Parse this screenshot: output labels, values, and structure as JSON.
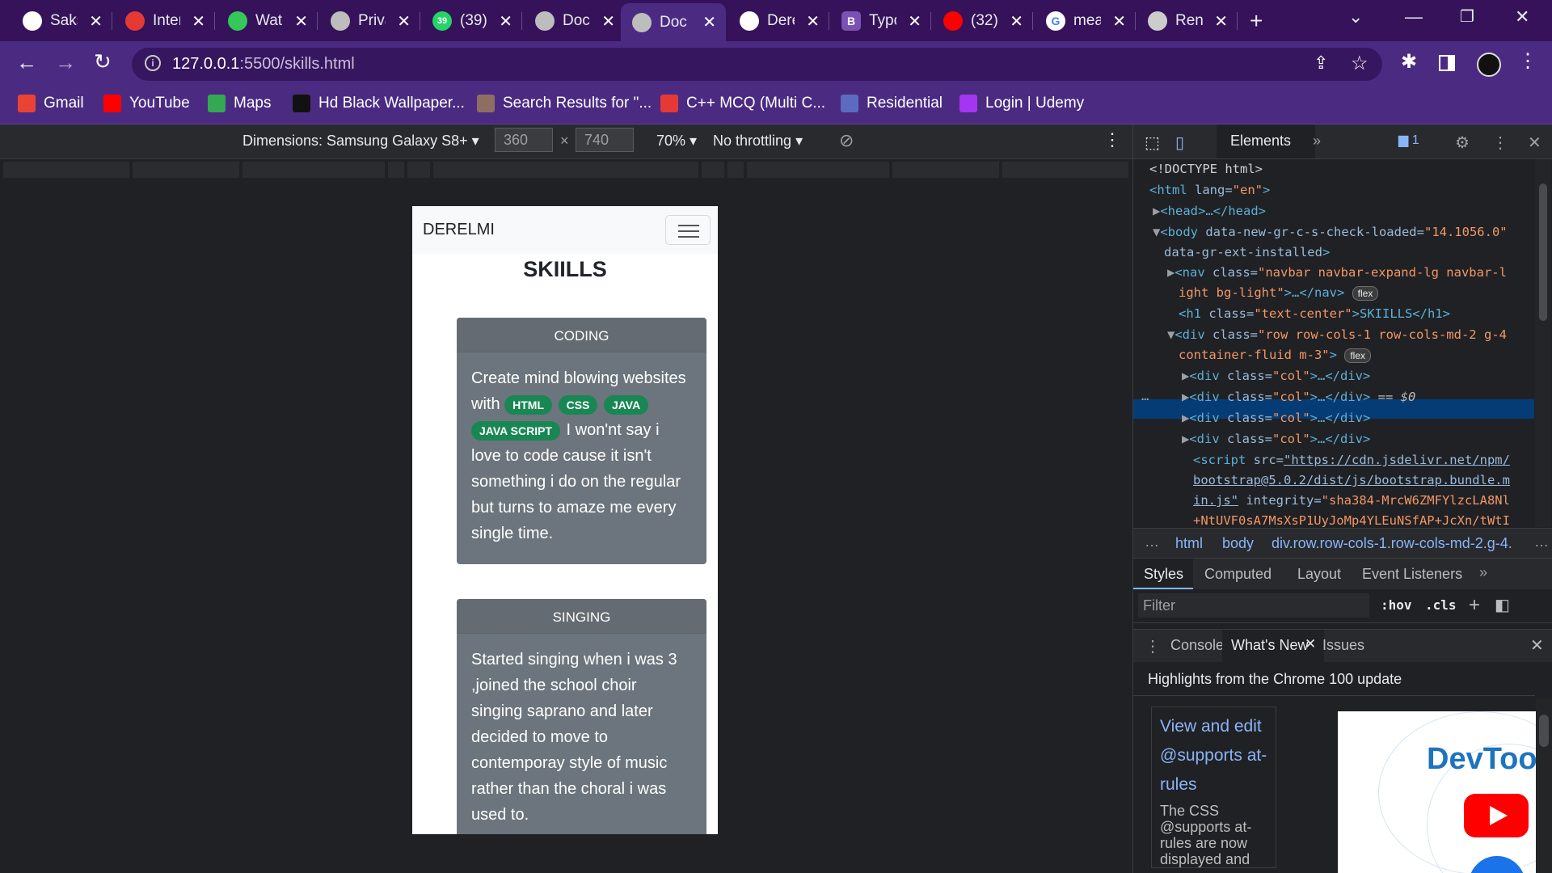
{
  "browser": {
    "tabs": [
      {
        "title": "Sakshi",
        "icon": "wallet-icon",
        "color": "#ffffff"
      },
      {
        "title": "Internet",
        "icon": "speed-icon",
        "color": "#e53935"
      },
      {
        "title": "Watch",
        "icon": "play-icon",
        "color": "#34c759"
      },
      {
        "title": "Privacy",
        "icon": "globe-icon",
        "color": "#bdbdbd"
      },
      {
        "title": "(39)",
        "icon": "whatsapp-icon",
        "color": "#25d366",
        "badge": "39"
      },
      {
        "title": "Docs",
        "icon": "globe-icon",
        "color": "#bdbdbd"
      },
      {
        "title": "Docs",
        "icon": "globe-icon",
        "color": "#bdbdbd",
        "active": true
      },
      {
        "title": "Derelmi",
        "icon": "github-icon",
        "color": "#ffffff"
      },
      {
        "title": "Typography",
        "icon": "bootstrap-icon",
        "color": "#7952b3",
        "letter": "B"
      },
      {
        "title": "(32)",
        "icon": "youtube-icon",
        "color": "#ff0000"
      },
      {
        "title": "meaning",
        "icon": "google-icon",
        "color": "#ffffff",
        "letter": "G"
      },
      {
        "title": "Render",
        "icon": "layers-icon",
        "color": "#cccccc"
      }
    ],
    "url_host": "127.0.0.1",
    "url_path": ":5500/skills.html",
    "bookmarks": [
      {
        "label": "Gmail",
        "icon": "gmail-icon",
        "color": "#ea4335"
      },
      {
        "label": "YouTube",
        "icon": "youtube-icon",
        "color": "#ff0000"
      },
      {
        "label": "Maps",
        "icon": "maps-icon",
        "color": "#34a853"
      },
      {
        "label": "Hd Black Wallpaper...",
        "icon": "wallpaper-icon",
        "color": "#111111"
      },
      {
        "label": "Search Results for \"...",
        "icon": "search-results-icon",
        "color": "#8d6e63"
      },
      {
        "label": "C++ MCQ (Multi C...",
        "icon": "cpp-icon",
        "color": "#e53935"
      },
      {
        "label": "Residential",
        "icon": "residential-icon",
        "color": "#5c6bc0"
      },
      {
        "label": "Login | Udemy",
        "icon": "udemy-icon",
        "color": "#a435f0"
      }
    ]
  },
  "device_toolbar": {
    "dimensions_label": "Dimensions: Samsung Galaxy S8+",
    "width": "360",
    "height": "740",
    "times": "×",
    "zoom": "70%",
    "throttling": "No throttling"
  },
  "page": {
    "brand": "DERELMI",
    "heading": "SKIILLS",
    "cards": [
      {
        "header": "CODING",
        "text_before": "Create mind blowing websites with",
        "badges": [
          "HTML",
          "CSS",
          "JAVA",
          "JAVA SCRIPT"
        ],
        "text_after": "I won'nt say i love to code cause it isn't something i do on the regular but turns to amaze me every single time."
      },
      {
        "header": "SINGING",
        "text": "Started singing when i was 3 ,joined the school choir singing saprano and later decided to move to contemporay style of music rather than the choral i was used to."
      }
    ]
  },
  "devtools": {
    "main_tab": "Elements",
    "issues_count": "1",
    "tree": {
      "l1": "<!DOCTYPE html>",
      "l2_tag": "<html",
      "l2_attr": " lang=",
      "l2_val": "\"en\"",
      "l2_end": ">",
      "l3": "<head>…</head>",
      "l4_tag": "<body",
      "l4_attr": " data-new-gr-c-s-check-loaded=",
      "l4_val": "\"14.1056.0\"",
      "l5_attr": "data-gr-ext-installed",
      "l5_end": ">",
      "l6_tag": "<nav",
      "l6_attr": " class=",
      "l6_val": "\"navbar navbar-expand-lg navbar-l",
      "l7_val": "ight bg-light\"",
      "l7_end": ">…</nav>",
      "flex": "flex",
      "l8_tag": "<h1",
      "l8_attr": " class=",
      "l8_val": "\"text-center\"",
      "l8_end": ">SKIILLS</h1>",
      "l9_tag": "<div",
      "l9_attr": " class=",
      "l9_val": "\"row row-cols-1 row-cols-md-2 g-4",
      "l10_val": "container-fluid m-3\"",
      "l10_end": ">",
      "col_tag": "<div",
      "col_attr": " class=",
      "col_val": "\"col\"",
      "col_end": ">…</div>",
      "selected_suffix": " == $0",
      "script_tag": "<script",
      "script_attr": " src=",
      "script_link1": "\"https://cdn.jsdelivr.net/npm/",
      "script_link2": "bootstrap@5.0.2/dist/js/bootstrap.bundle.m",
      "script_link3": "in.js\"",
      "script_attr2": " integrity=",
      "script_val2": "\"sha384-MrcW6ZMFYlzcLA8Nl",
      "script_val3": "+NtUVF0sA7MsXsP1UyJoMp4YLEuNSfAP+JcXn/tWtI"
    },
    "breadcrumbs": [
      "html",
      "body",
      "div.row.row-cols-1.row-cols-md-2.g-4."
    ],
    "styles_tabs": [
      "Styles",
      "Computed",
      "Layout",
      "Event Listeners"
    ],
    "filter_placeholder": "Filter",
    "hov": ":hov",
    "cls": ".cls",
    "drawer_tabs": [
      "Console",
      "What's New",
      "Issues"
    ],
    "whats_new_heading": "Highlights from the Chrome 100 update",
    "feature_link": "View and edit @supports at-rules",
    "feature_desc": "The CSS @supports at-rules are now displayed and editable in the",
    "video_brand": "DevTools"
  }
}
